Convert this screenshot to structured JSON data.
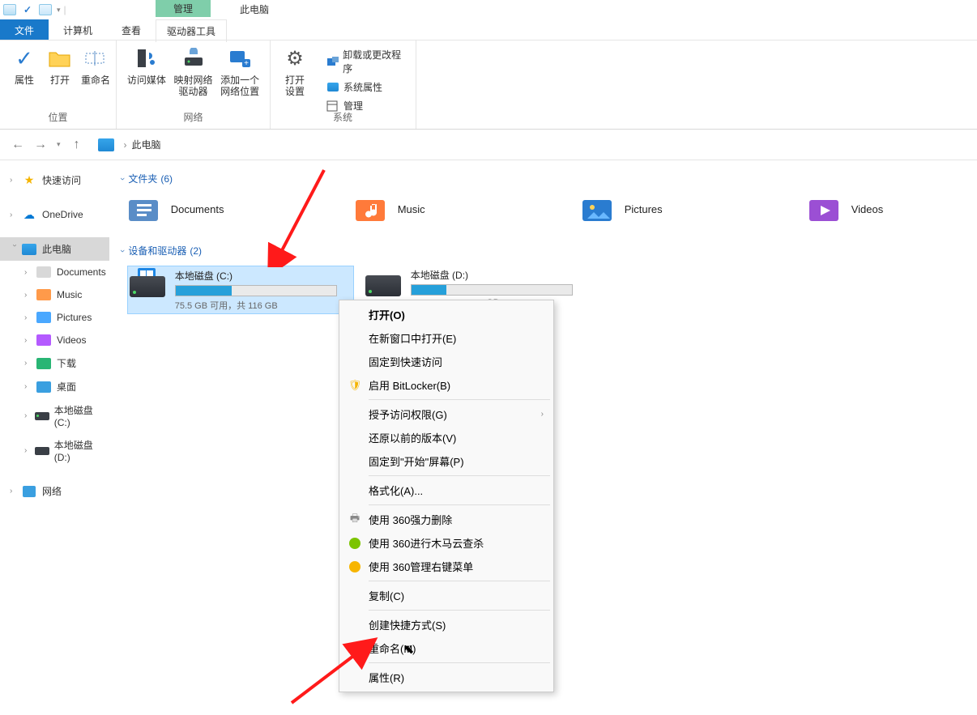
{
  "titlebar": {
    "manage": "管理",
    "title": "此电脑"
  },
  "tabs": {
    "file": "文件",
    "computer": "计算机",
    "view": "查看",
    "drive_tools": "驱动器工具"
  },
  "ribbon": {
    "location": {
      "label": "位置",
      "props": "属性",
      "open": "打开",
      "rename": "重命名"
    },
    "network": {
      "label": "网络",
      "access_media": "访问媒体",
      "map_drive": "映射网络\n驱动器",
      "add_location": "添加一个\n网络位置"
    },
    "system": {
      "label": "系统",
      "open_settings": "打开\n设置",
      "uninstall": "卸载或更改程序",
      "sysprops": "系统属性",
      "manage": "管理"
    }
  },
  "nav": {
    "this_pc": "此电脑"
  },
  "sidebar": {
    "quick": "快速访问",
    "onedrive": "OneDrive",
    "this_pc": "此电脑",
    "documents": "Documents",
    "music": "Music",
    "pictures": "Pictures",
    "videos": "Videos",
    "downloads": "下载",
    "desktop": "桌面",
    "drive_c": "本地磁盘 (C:)",
    "drive_d": "本地磁盘 (D:)",
    "network": "网络"
  },
  "content": {
    "folders_header": "文件夹",
    "folders_count": "(6)",
    "folders": {
      "documents": "Documents",
      "music": "Music",
      "pictures": "Pictures",
      "videos": "Videos"
    },
    "drives_header": "设备和驱动器",
    "drives_count": "(2)",
    "drive_c": {
      "name": "本地磁盘 (C:)",
      "status": "75.5 GB 可用，共 116 GB",
      "fillpct": "35%"
    },
    "drive_d": {
      "name": "本地磁盘 (D:)",
      "status_suffix": "GB",
      "fillpct": "22%"
    }
  },
  "ctx": {
    "open": "打开(O)",
    "open_new": "在新窗口中打开(E)",
    "pin_quick": "固定到快速访问",
    "bitlocker": "启用 BitLocker(B)",
    "grant_access": "授予访问权限(G)",
    "restore": "还原以前的版本(V)",
    "pin_start": "固定到\"开始\"屏幕(P)",
    "format": "格式化(A)...",
    "del360": "使用 360强力删除",
    "scan360": "使用 360进行木马云查杀",
    "menu360": "使用 360管理右键菜单",
    "copy": "复制(C)",
    "shortcut": "创建快捷方式(S)",
    "rename": "重命名(M)",
    "properties": "属性(R)"
  }
}
